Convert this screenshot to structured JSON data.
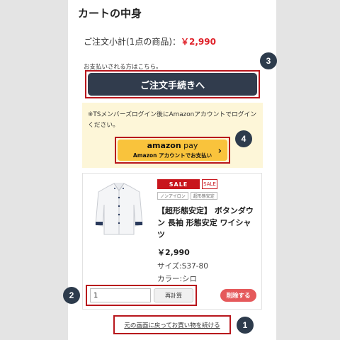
{
  "cart": {
    "title": "カートの中身",
    "subtotal_label": "ご注文小計(1点の商品)：",
    "subtotal_price": "￥2,990",
    "pay_note": "お支払いされる方はこちら。",
    "checkout_label": "ご注文手続きへ"
  },
  "amazon": {
    "note": "※TSメンバーズログイン後にAmazonアカウントでログインください。",
    "logo_main": "amazon",
    "logo_pay": " pay",
    "button_sub": "Amazon アカウントでお支払い",
    "arrow": "›"
  },
  "item": {
    "sale_badge": "SALE",
    "sale_badge_small": "SALE",
    "tags": [
      "ノンアイロン",
      "超形態安定"
    ],
    "name": "【超形態安定】 ボタンダウン 長袖 形態安定 ワイシャツ",
    "price": "￥2,990",
    "size": "サイズ:S37-80",
    "color": "カラー:シロ",
    "quantity": "1",
    "recalc_label": "再計算",
    "delete_label": "削除する"
  },
  "continue_link": "元の画面に戻ってお買い物を続ける",
  "markers": [
    "1",
    "2",
    "3",
    "4"
  ],
  "colors": {
    "accent_red": "#e0232b",
    "checkout_bg": "#313c4d",
    "amazon_yellow": "#f9c33c",
    "highlight_border": "#b8161c",
    "marker_bg": "#2d3b4c"
  }
}
